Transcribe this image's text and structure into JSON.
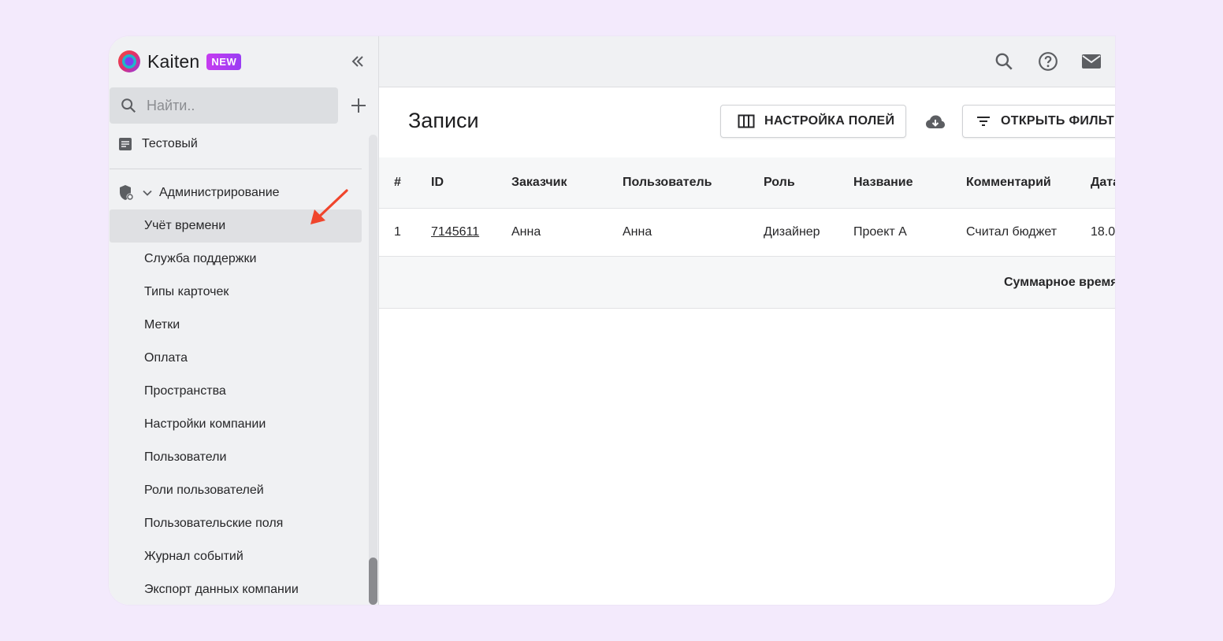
{
  "app": {
    "name": "Kaiten",
    "badge": "NEW",
    "colors": {
      "accent": "#c63cf0",
      "arrow": "#f0452c",
      "background": "#f3eafc"
    }
  },
  "sidebar": {
    "search_placeholder": "Найти..",
    "space_item": "Тестовый",
    "section_title": "Администрирование",
    "items": [
      {
        "label": "Учёт времени",
        "active": true
      },
      {
        "label": "Служба поддержки"
      },
      {
        "label": "Типы карточек"
      },
      {
        "label": "Метки"
      },
      {
        "label": "Оплата"
      },
      {
        "label": "Пространства"
      },
      {
        "label": "Настройки компании"
      },
      {
        "label": "Пользователи"
      },
      {
        "label": "Роли пользователей"
      },
      {
        "label": "Пользовательские поля"
      },
      {
        "label": "Журнал событий"
      },
      {
        "label": "Экспорт данных компании"
      }
    ]
  },
  "topbar": {
    "icons": [
      "search-icon",
      "help-icon",
      "mail-icon"
    ]
  },
  "main": {
    "title": "Записи",
    "fields_button": "НАСТРОЙКА ПОЛЕЙ",
    "filter_button": "ОТКРЫТЬ ФИЛЬТР",
    "table": {
      "headers": [
        "#",
        "ID",
        "Заказчик",
        "Пользователь",
        "Роль",
        "Название",
        "Комментарий",
        "Дата"
      ],
      "rows": [
        [
          "1",
          "7145611",
          "Анна",
          "Анна",
          "Дизайнер",
          "Проект А",
          "Считал бюджет",
          "18.0"
        ]
      ],
      "footer_label": "Суммарное время"
    }
  }
}
